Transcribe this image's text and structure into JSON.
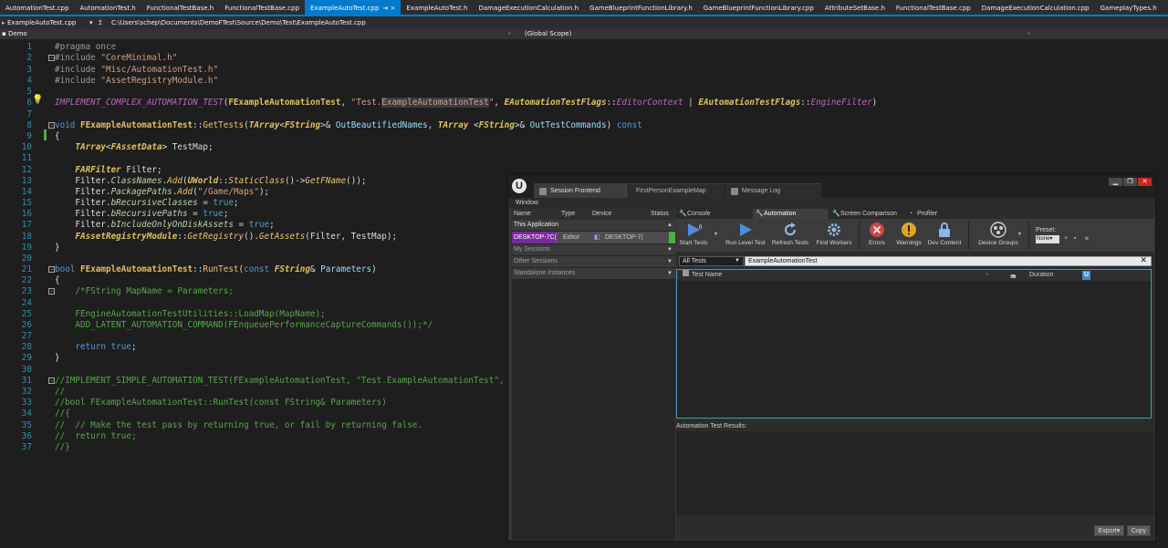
{
  "vs": {
    "tabs": [
      {
        "label": "AutomationTest.cpp",
        "active": false
      },
      {
        "label": "AutomationTest.h",
        "active": false
      },
      {
        "label": "FunctionalTestBase.h",
        "active": false
      },
      {
        "label": "FunctionalTestBase.cpp",
        "active": false
      },
      {
        "label": "ExampleAutoTest.cpp",
        "active": true
      },
      {
        "label": "ExampleAutoTest.h",
        "active": false
      },
      {
        "label": "DamageExecutionCalculation.h",
        "active": false
      },
      {
        "label": "GameBlueprintFunctionLibrary.h",
        "active": false
      },
      {
        "label": "GameBlueprintFunctionLibrary.cpp",
        "active": false
      },
      {
        "label": "AttributeSetBase.h",
        "active": false
      },
      {
        "label": "FunctionalTestBase.cpp",
        "active": false
      },
      {
        "label": "DamageExecutionCalculation.cpp",
        "active": false
      },
      {
        "label": "GameplayTypes.h",
        "active": false
      }
    ],
    "active_tab_close": "⇥ ×",
    "pathbar": {
      "file_dropdown": "ExampleAutoTest.cpp",
      "path": "C:\\Users\\schep\\Documents\\DemoFTest\\Source\\Demo\\Test\\ExampleAutoTest.cpp"
    },
    "navbar": {
      "project": "Demo",
      "scope": "(Global Scope)"
    }
  },
  "code_lines": [
    {
      "n": "1",
      "segs": [
        [
          "pp",
          "#pragma once"
        ]
      ]
    },
    {
      "n": "2",
      "fold": "−",
      "segs": [
        [
          "pp",
          "#include "
        ],
        [
          "str",
          "\"CoreMinimal.h\""
        ]
      ]
    },
    {
      "n": "3",
      "segs": [
        [
          "pp",
          "#include "
        ],
        [
          "str",
          "\"Misc/AutomationTest.h\""
        ]
      ]
    },
    {
      "n": "4",
      "segs": [
        [
          "pp",
          "#include "
        ],
        [
          "str",
          "\"AssetRegistryModule.h\""
        ]
      ]
    },
    {
      "n": "5",
      "segs": []
    },
    {
      "n": "6",
      "segs": [
        [
          "mac",
          "IMPLEMENT_COMPLEX_AUTOMATION_TEST"
        ],
        [
          "pl",
          "("
        ],
        [
          "cls",
          "FExampleAutomationTest"
        ],
        [
          "pl",
          ", "
        ],
        [
          "str",
          "\"Test."
        ],
        [
          "strhl",
          "ExampleAutomationTest"
        ],
        [
          "str",
          "\""
        ],
        [
          "pl",
          ", "
        ],
        [
          "cls it",
          "EAutomationTestFlags"
        ],
        [
          "pl",
          "::"
        ],
        [
          "mac",
          "EditorContext"
        ],
        [
          "pl",
          " | "
        ],
        [
          "cls it",
          "EAutomationTestFlags"
        ],
        [
          "pl",
          "::"
        ],
        [
          "mac",
          "EngineFilter"
        ],
        [
          "pl",
          ")"
        ]
      ]
    },
    {
      "n": "7",
      "segs": []
    },
    {
      "n": "8",
      "fold": "−",
      "segs": [
        [
          "kw",
          "void "
        ],
        [
          "cls",
          "FExampleAutomationTest"
        ],
        [
          "pl",
          "::"
        ],
        [
          "fn",
          "GetTests"
        ],
        [
          "pl",
          "("
        ],
        [
          "cls it",
          "TArray"
        ],
        [
          "pl",
          "<"
        ],
        [
          "cls it",
          "FString"
        ],
        [
          "pl",
          ">& "
        ],
        [
          "par",
          "OutBeautifiedNames"
        ],
        [
          "pl",
          ", "
        ],
        [
          "cls it",
          "TArray "
        ],
        [
          "pl",
          "<"
        ],
        [
          "cls it",
          "FString"
        ],
        [
          "pl",
          ">& "
        ],
        [
          "par",
          "OutTestCommands"
        ],
        [
          "pl",
          ") "
        ],
        [
          "kw",
          "const"
        ]
      ]
    },
    {
      "n": "9",
      "segs": [
        [
          "pl",
          "{"
        ]
      ]
    },
    {
      "n": "10",
      "segs": [
        [
          "pl",
          "    "
        ],
        [
          "cls it",
          "TArray"
        ],
        [
          "pl",
          "<"
        ],
        [
          "cls it",
          "FAssetData"
        ],
        [
          "pl",
          "> TestMap;"
        ]
      ]
    },
    {
      "n": "11",
      "segs": []
    },
    {
      "n": "12",
      "segs": [
        [
          "pl",
          "    "
        ],
        [
          "cls it",
          "FARFilter"
        ],
        [
          "pl",
          " Filter;"
        ]
      ]
    },
    {
      "n": "13",
      "segs": [
        [
          "pl",
          "    Filter."
        ],
        [
          "enm it",
          "ClassNames"
        ],
        [
          "pl",
          "."
        ],
        [
          "fn it",
          "Add"
        ],
        [
          "pl",
          "("
        ],
        [
          "cls it",
          "UWorld"
        ],
        [
          "pl",
          "::"
        ],
        [
          "fn it",
          "StaticClass"
        ],
        [
          "pl",
          "()->"
        ],
        [
          "fn it",
          "GetFName"
        ],
        [
          "pl",
          "());"
        ]
      ]
    },
    {
      "n": "14",
      "segs": [
        [
          "pl",
          "    Filter."
        ],
        [
          "enm it",
          "PackagePaths"
        ],
        [
          "pl",
          "."
        ],
        [
          "fn it",
          "Add"
        ],
        [
          "pl",
          "("
        ],
        [
          "str",
          "\"/Game/Maps\""
        ],
        [
          "pl",
          ");"
        ]
      ]
    },
    {
      "n": "15",
      "segs": [
        [
          "pl",
          "    Filter."
        ],
        [
          "enm it",
          "bRecursiveClasses"
        ],
        [
          "pl",
          " = "
        ],
        [
          "kw",
          "true"
        ],
        [
          "pl",
          ";"
        ]
      ]
    },
    {
      "n": "16",
      "segs": [
        [
          "pl",
          "    Filter."
        ],
        [
          "enm it",
          "bRecursivePaths"
        ],
        [
          "pl",
          " = "
        ],
        [
          "kw",
          "true"
        ],
        [
          "pl",
          ";"
        ]
      ]
    },
    {
      "n": "17",
      "segs": [
        [
          "pl",
          "    Filter."
        ],
        [
          "enm it",
          "bIncludeOnlyOnDiskAssets"
        ],
        [
          "pl",
          " = "
        ],
        [
          "kw",
          "true"
        ],
        [
          "pl",
          ";"
        ]
      ]
    },
    {
      "n": "18",
      "segs": [
        [
          "pl",
          "    "
        ],
        [
          "cls it",
          "FAssetRegistryModule"
        ],
        [
          "pl",
          "::"
        ],
        [
          "fn it",
          "GetRegistry"
        ],
        [
          "pl",
          "()."
        ],
        [
          "fn it",
          "GetAssets"
        ],
        [
          "pl",
          "(Filter, TestMap);"
        ]
      ]
    },
    {
      "n": "19",
      "segs": [
        [
          "pl",
          "}"
        ]
      ]
    },
    {
      "n": "20",
      "segs": []
    },
    {
      "n": "21",
      "fold": "−",
      "segs": [
        [
          "kw",
          "bool "
        ],
        [
          "cls",
          "FExampleAutomationTest"
        ],
        [
          "pl",
          "::"
        ],
        [
          "fn",
          "RunTest"
        ],
        [
          "pl",
          "("
        ],
        [
          "kw",
          "const "
        ],
        [
          "cls it",
          "FString"
        ],
        [
          "pl",
          "& "
        ],
        [
          "par",
          "Parameters"
        ],
        [
          "pl",
          ")"
        ]
      ]
    },
    {
      "n": "22",
      "segs": [
        [
          "pl",
          "{"
        ]
      ]
    },
    {
      "n": "23",
      "fold": "−",
      "segs": [
        [
          "cm",
          "    /*FString MapName = Parameters;"
        ]
      ]
    },
    {
      "n": "24",
      "segs": [
        [
          "cm",
          "    "
        ]
      ]
    },
    {
      "n": "25",
      "segs": [
        [
          "cm",
          "    FEngineAutomationTestUtilities::LoadMap(MapName);"
        ]
      ]
    },
    {
      "n": "26",
      "segs": [
        [
          "cm",
          "    ADD_LATENT_AUTOMATION_COMMAND(FEnqueuePerformanceCaptureCommands());*/"
        ]
      ]
    },
    {
      "n": "27",
      "segs": []
    },
    {
      "n": "28",
      "segs": [
        [
          "pl",
          "    "
        ],
        [
          "kw",
          "return true"
        ],
        [
          "pl",
          ";"
        ]
      ]
    },
    {
      "n": "29",
      "segs": [
        [
          "pl",
          "}"
        ]
      ]
    },
    {
      "n": "30",
      "segs": []
    },
    {
      "n": "31",
      "fold": "−",
      "segs": [
        [
          "cm",
          "//IMPLEMENT_SIMPLE_AUTOMATION_TEST(FExampleAutomationTest, \"Test.ExampleAutomationTest\", EAutoma"
        ]
      ]
    },
    {
      "n": "32",
      "segs": [
        [
          "cm",
          "//"
        ]
      ]
    },
    {
      "n": "33",
      "segs": [
        [
          "cm",
          "//bool FExampleAutomationTest::RunTest(const FString& Parameters)"
        ]
      ]
    },
    {
      "n": "34",
      "segs": [
        [
          "cm",
          "//{"
        ]
      ]
    },
    {
      "n": "35",
      "segs": [
        [
          "cm",
          "//  // Make the test pass by returning true, or fail by returning false."
        ]
      ]
    },
    {
      "n": "36",
      "segs": [
        [
          "cm",
          "//  return true;"
        ]
      ]
    },
    {
      "n": "37",
      "segs": [
        [
          "cm",
          "//}"
        ]
      ]
    }
  ],
  "ue": {
    "title_tabs": [
      "Session Frontend",
      "FirstPersonExampleMap",
      "Message Log"
    ],
    "menu": "Window",
    "logo": "U",
    "window_buttons": [
      "▁",
      "❐",
      "✕"
    ],
    "session": {
      "columns": [
        "Name",
        "Type",
        "Device",
        "Status"
      ],
      "groups": [
        "This Application",
        "My Sessions",
        "Other Sessions",
        "Standalone Instances"
      ],
      "row": {
        "name": "DESKTOP-7C(",
        "type": "Editor",
        "device": "DESKTOP-7("
      }
    },
    "automation": {
      "subtabs": [
        "Console",
        "Automation",
        "Screen Comparison",
        "Profiler"
      ],
      "toolbar": {
        "start_tests": "Start Tests",
        "start_count": "0",
        "run_level_test": "Run Level Test",
        "refresh_tests": "Refresh Tests",
        "find_workers": "Find Workers",
        "errors": "Errors",
        "warnings": "Warnings",
        "dev_content": "Dev Content",
        "device_groups": "Device Groups",
        "preset_label": "Preset:",
        "preset_value": "None"
      },
      "filter": "All Tests",
      "search_value": "ExampleAutomationTest",
      "columns": {
        "test_name": "Test Name",
        "duration": "Duration"
      },
      "results_label": "Automation Test Results:",
      "export": "Export▾",
      "copy": "Copy"
    }
  }
}
